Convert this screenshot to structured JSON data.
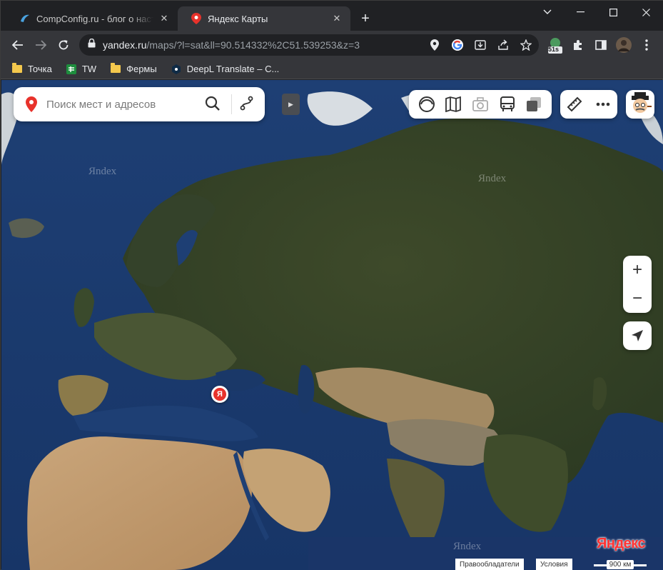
{
  "browser": {
    "tabs": [
      {
        "title": "CompConfig.ru - блог о настрой",
        "active": false,
        "favicon": "compconfig-favicon"
      },
      {
        "title": "Яндекс Карты",
        "active": true,
        "favicon": "yandex-maps-pin-favicon"
      }
    ],
    "new_tab_label": "+",
    "window_controls": {
      "minimize": "⌄",
      "restore": "—",
      "maximize": "☐",
      "close": "✕"
    },
    "url": {
      "host": "yandex.ru",
      "path": "/maps/?l=sat&ll=90.514332%2C51.539253&z=3"
    },
    "extension_badge": "51s",
    "bookmarks": [
      {
        "label": "Точка",
        "icon": "folder-icon"
      },
      {
        "label": "TW",
        "icon": "sheets-icon"
      },
      {
        "label": "Фермы",
        "icon": "folder-icon"
      },
      {
        "label": "DeepL Translate – C...",
        "icon": "deepl-icon"
      }
    ]
  },
  "map": {
    "search_placeholder": "Поиск мест и адресов",
    "marker_letter": "Я",
    "watermarks": [
      "Яndex",
      "Яndex",
      "Яndex"
    ],
    "logo": "Яндекс",
    "footer": {
      "rights": "Правообладатели",
      "terms": "Условия",
      "scale": "900 км"
    },
    "zoom_in": "+",
    "zoom_out": "−",
    "more": "•••"
  },
  "colors": {
    "accent_red": "#e8322b",
    "chrome_dark": "#202124",
    "chrome_toolbar": "#35363a"
  }
}
